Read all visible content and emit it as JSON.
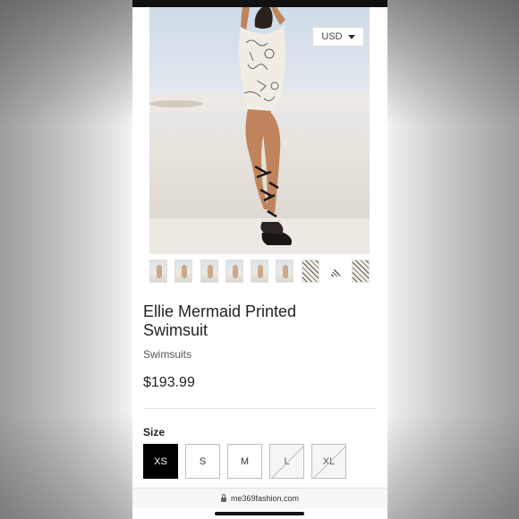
{
  "currency": {
    "selected": "USD"
  },
  "product": {
    "title": "Ellie Mermaid Printed Swimsuit",
    "category": "Swimsuits",
    "price": "$193.99"
  },
  "size_selector": {
    "label": "Size",
    "options": [
      {
        "label": "XS",
        "state": "selected"
      },
      {
        "label": "S",
        "state": "available"
      },
      {
        "label": "M",
        "state": "available"
      },
      {
        "label": "L",
        "state": "unavailable"
      },
      {
        "label": "XL",
        "state": "unavailable"
      }
    ]
  },
  "browser": {
    "url": "me369fashion.com"
  },
  "icons": [
    "chevron-down-icon",
    "lock-icon"
  ]
}
